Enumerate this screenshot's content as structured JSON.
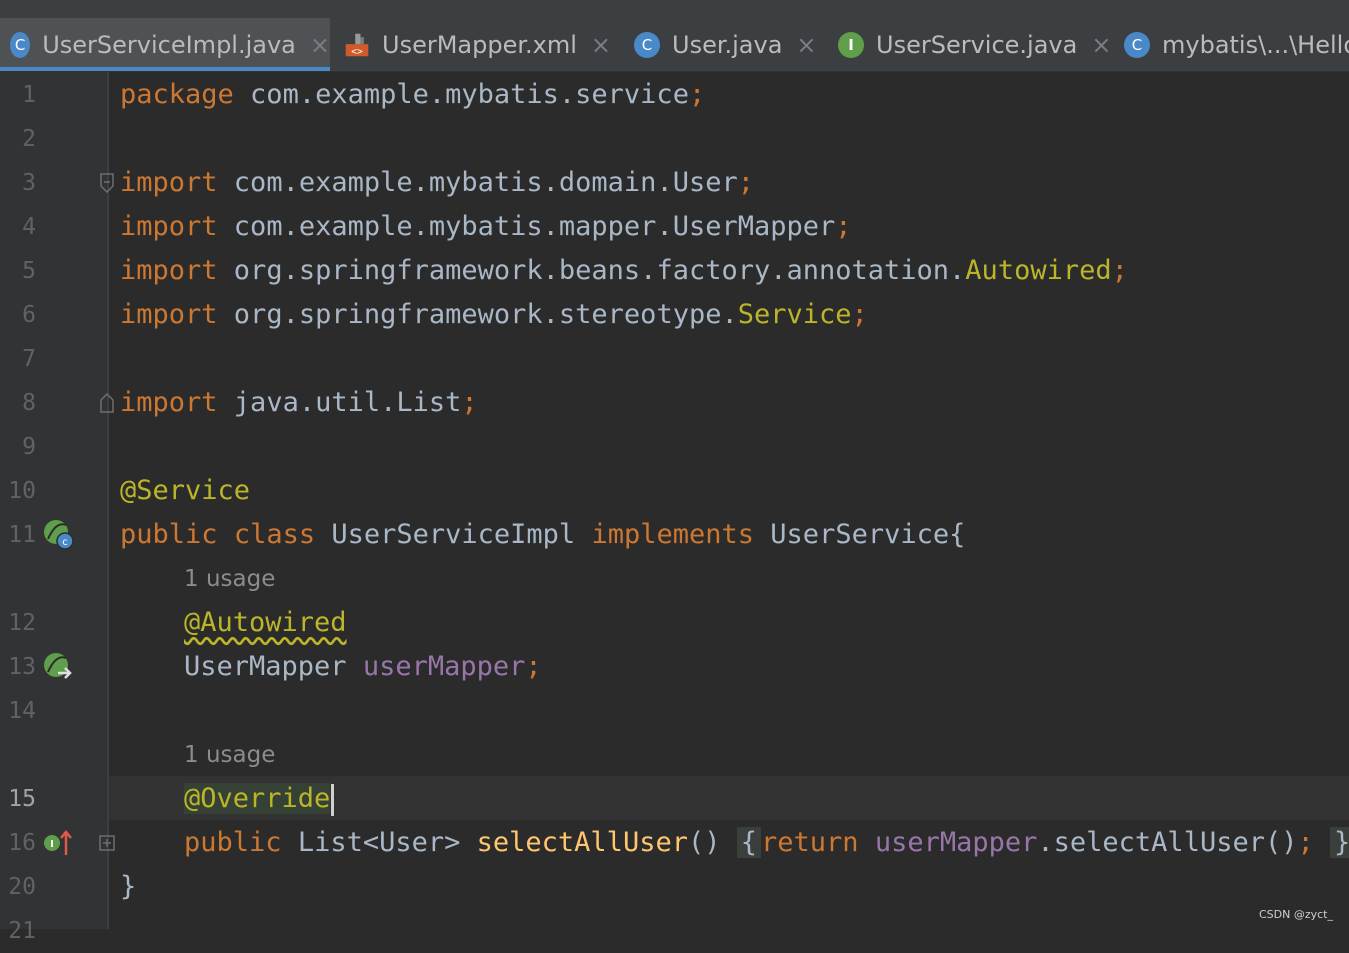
{
  "tabs": [
    {
      "label": "UserServiceImpl.java",
      "icon": "class-icon",
      "icon_letter": "C",
      "active": true
    },
    {
      "label": "UserMapper.xml",
      "icon": "xml-icon",
      "icon_letter": "<>",
      "active": false
    },
    {
      "label": "User.java",
      "icon": "class-icon",
      "icon_letter": "C",
      "active": false
    },
    {
      "label": "UserService.java",
      "icon": "interface-icon",
      "icon_letter": "I",
      "active": false
    },
    {
      "label": "mybatis\\...\\Hello",
      "icon": "class-icon",
      "icon_letter": "C",
      "active": false
    }
  ],
  "tab_close_glyph": "×",
  "code": {
    "l1": {
      "num": "1",
      "kw": "package",
      "rest": " com.example.mybatis.service",
      "semi": ";"
    },
    "l2": {
      "num": "2"
    },
    "l3": {
      "num": "3",
      "kw": "import",
      "rest": " com.example.mybatis.domain.User",
      "semi": ";"
    },
    "l4": {
      "num": "4",
      "kw": "import",
      "rest": " com.example.mybatis.mapper.UserMapper",
      "semi": ";"
    },
    "l5": {
      "num": "5",
      "kw": "import",
      "rest": " org.springframework.beans.factory.annotation.",
      "ann": "Autowired",
      "semi": ";"
    },
    "l6": {
      "num": "6",
      "kw": "import",
      "rest": " org.springframework.stereotype.",
      "ann": "Service",
      "semi": ";"
    },
    "l7": {
      "num": "7"
    },
    "l8": {
      "num": "8",
      "kw": "import",
      "rest": " java.util.List",
      "semi": ";"
    },
    "l9": {
      "num": "9"
    },
    "l10": {
      "num": "10",
      "ann": "@Service"
    },
    "l11": {
      "num": "11",
      "kw1": "public",
      "kw2": "class",
      "name": "UserServiceImpl",
      "kw3": "implements",
      "iface": "UserService{"
    },
    "hint1": "1 usage",
    "l12": {
      "num": "12",
      "ann": "@Autowired"
    },
    "l13": {
      "num": "13",
      "type": "UserMapper",
      "field": "userMapper",
      "semi": ";"
    },
    "l14": {
      "num": "14"
    },
    "hint2": "1 usage",
    "l15": {
      "num": "15",
      "ann": "@Override"
    },
    "l16": {
      "num": "16",
      "kw": "public",
      "type": "List<User>",
      "method": "selectAllUser",
      "parens": "()",
      "ob": "{",
      "ret": "return",
      "field": "userMapper",
      "call": ".selectAllUser()",
      "semi": ";",
      "cb": "}"
    },
    "l20": {
      "num": "20",
      "brace": "}"
    },
    "l21": {
      "num": "21"
    }
  },
  "colors": {
    "keyword": "#cc7832",
    "annotation": "#bbb529",
    "field": "#9876aa",
    "method": "#ffc66d",
    "text": "#a9b7c6"
  },
  "watermark": "CSDN @zyct_"
}
